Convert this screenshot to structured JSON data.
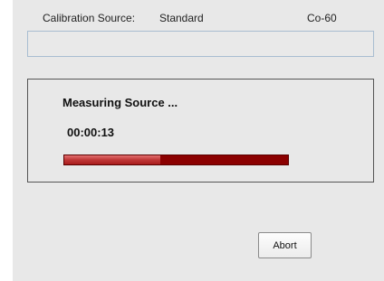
{
  "header": {
    "source_label": "Calibration Source:",
    "source_value": "Standard",
    "isotope": "Co-60"
  },
  "status_field": {
    "value": ""
  },
  "measurement": {
    "title": "Measuring Source ...",
    "elapsed": "00:00:13",
    "progress_fraction": 0.43,
    "track_color": "#8b0000",
    "fill_color": "#c23a3a"
  },
  "actions": {
    "abort_label": "Abort"
  }
}
